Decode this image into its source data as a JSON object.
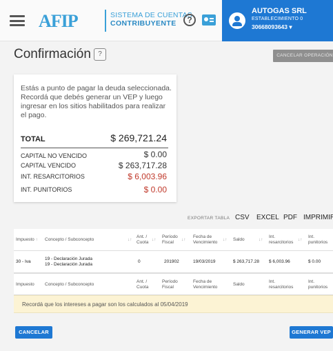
{
  "header": {
    "logo": "AFIP",
    "system_line1": "SISTEMA DE CUENTAS",
    "system_line2": "CONTRIBUYENTE",
    "help_glyph": "?",
    "user": {
      "name": "AUTOGAS SRL",
      "establishment": "ESTABLECIMIENTO 0",
      "cuit": "30668093643 ▾"
    }
  },
  "page": {
    "title": "Confirmación",
    "help_glyph": "?",
    "cancel_operation": "CANCELAR OPERACIÓN"
  },
  "summary": {
    "message": "Estás a punto de pagar la deuda seleccionada. Recordá que debés generar un VEP y luego ingresar en los sitios habilitados para realizar el pago.",
    "total_label": "TOTAL",
    "total_value": "$ 269,721.24",
    "rows": [
      {
        "label": "CAPITAL NO VENCIDO",
        "value": "$ 0.00"
      },
      {
        "label": "CAPITAL VENCIDO",
        "value": "$ 263,717.28"
      },
      {
        "label": "INT. RESARCITORIOS",
        "value": "$ 6,003.96"
      },
      {
        "label": "INT. PUNITORIOS",
        "value": "$ 0.00"
      }
    ]
  },
  "export": {
    "label": "EXPORTAR TABLA",
    "csv": "CSV",
    "excel": "EXCEL",
    "pdf": "PDF",
    "print": "IMPRIMIR"
  },
  "table": {
    "headers": {
      "impuesto": "Impuesto",
      "concepto": "Concepto / Subconcepto",
      "ant_cuota_1": "Ant. /",
      "ant_cuota_2": "Cuota",
      "periodo_1": "Período",
      "periodo_2": "Fiscal",
      "fecha_1": "Fecha de",
      "fecha_2": "Vencimiento",
      "saldo": "Saldo",
      "int_res_1": "Int.",
      "int_res_2": "resarcitorios",
      "int_pun_1": "Int.",
      "int_pun_2": "punitorios"
    },
    "sort_up": "↑",
    "sort_both": "↓↑",
    "rows": [
      {
        "impuesto": "30 - Iva",
        "concepto_1": "19 - Declaración Jurada",
        "concepto_2": "19 - Declaración Jurada",
        "ant_cuota": "0",
        "periodo": "201902",
        "fecha": "19/03/2019",
        "saldo": "$ 263,717.28",
        "int_res": "$ 6,003.96",
        "int_pun": "$ 0.00"
      }
    ]
  },
  "notice": "Recordá que los intereses a pagar son los calculados al 05/04/2019",
  "buttons": {
    "cancel": "CANCELAR",
    "generate": "GENERAR VEP"
  },
  "colors": {
    "accent": "#1e78d3",
    "logo": "#3aa0d8",
    "red_value": "#c0392b",
    "notice_bg": "#fcf3d4"
  }
}
